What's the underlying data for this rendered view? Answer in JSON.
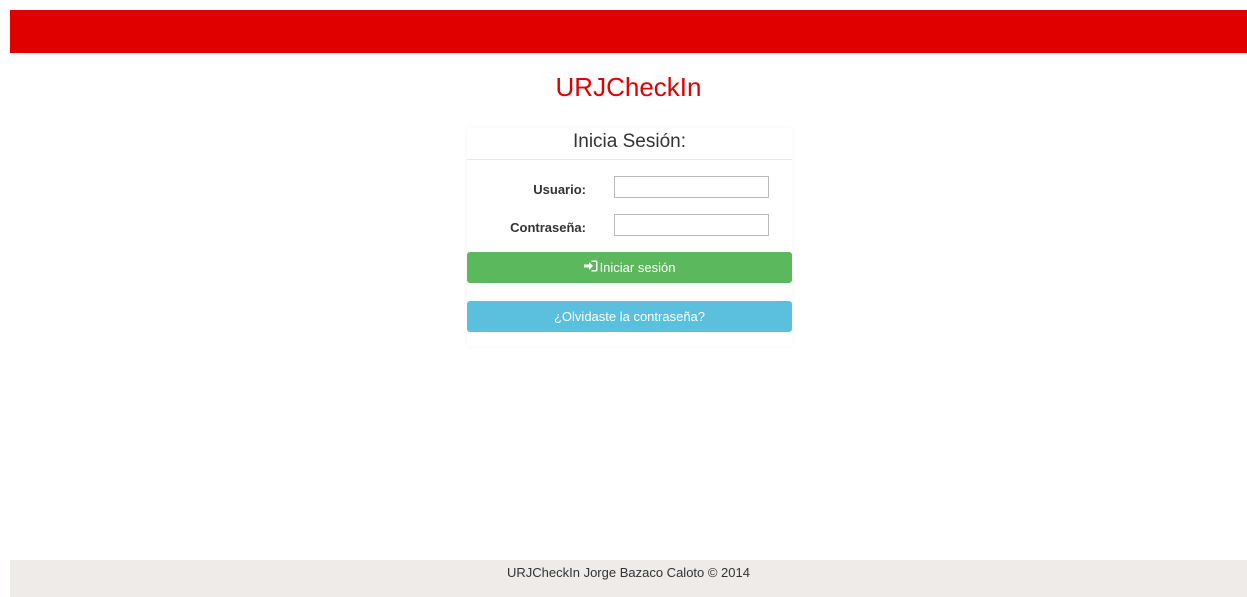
{
  "header": {
    "bar_color": "#e00000"
  },
  "app": {
    "title": "URJCheckIn"
  },
  "login": {
    "heading": "Inicia Sesión:",
    "username_label": "Usuario:",
    "username_value": "",
    "password_label": "Contraseña:",
    "password_value": "",
    "login_button_label": "Iniciar sesión",
    "login_button_icon": "sign-in-icon",
    "login_button_color": "#5cb85c",
    "forgot_link_label": "¿Olvidaste la contraseña?",
    "forgot_button_color": "#5bc0de"
  },
  "footer": {
    "text": "URJCheckIn Jorge Bazaco Caloto © 2014"
  }
}
